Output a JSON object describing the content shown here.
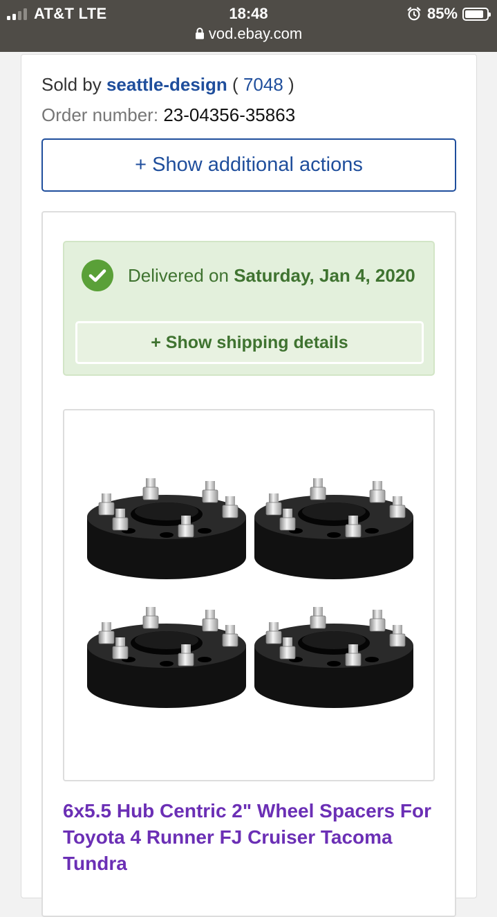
{
  "status_bar": {
    "carrier": "AT&T LTE",
    "time": "18:48",
    "battery": "85%",
    "battery_level": 0.85,
    "icons": [
      "signal-icon",
      "alarm-icon",
      "battery-icon"
    ]
  },
  "browser": {
    "url": "vod.ebay.com",
    "lock_icon": "lock-icon"
  },
  "order": {
    "sold_by_label": "Sold by",
    "seller_name": "seattle-design",
    "feedback_open": "(",
    "feedback_score": "7048",
    "feedback_close": ")",
    "order_number_label": "Order number:",
    "order_number": "23-04356-35863",
    "additional_actions": "+ Show additional actions"
  },
  "delivery": {
    "icon": "check-circle-icon",
    "prefix": "Delivered on",
    "date": "Saturday, Jan 4, 2020",
    "shipping_details_button": "+ Show shipping details"
  },
  "item": {
    "image": "wheel-spacers-photo",
    "title": "6x5.5 Hub Centric 2\" Wheel Spacers For Toyota 4 Runner FJ Cruiser Tacoma Tundra"
  },
  "colors": {
    "status_bar_bg": "#4f4c47",
    "ebay_blue": "#1f4e9c",
    "delivered_green": "#3f7330",
    "delivered_bg": "#e3f0dc",
    "item_link_purple": "#6b2fb5",
    "check_green": "#5aa038"
  }
}
